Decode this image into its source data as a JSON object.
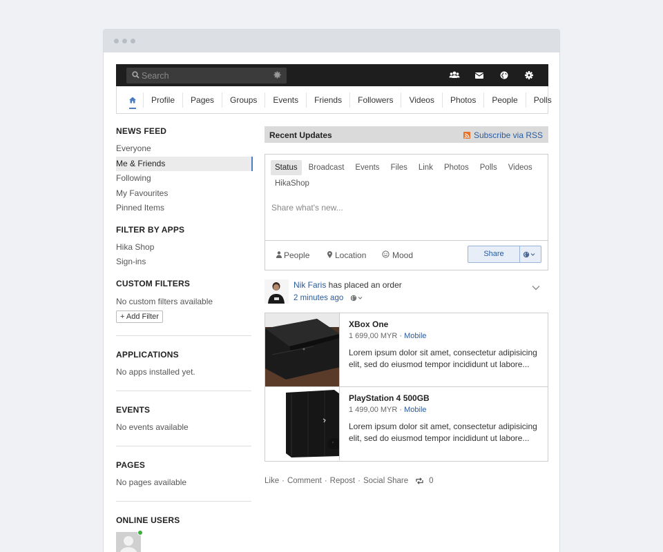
{
  "search": {
    "placeholder": "Search"
  },
  "nav": {
    "items": [
      "Profile",
      "Pages",
      "Groups",
      "Events",
      "Friends",
      "Followers",
      "Videos",
      "Photos",
      "People",
      "Polls"
    ]
  },
  "sidebar": {
    "news_feed_title": "NEWS FEED",
    "feed_items": [
      "Everyone",
      "Me & Friends",
      "Following",
      "My Favourites",
      "Pinned Items"
    ],
    "filter_apps_title": "FILTER BY APPS",
    "app_items": [
      "Hika Shop",
      "Sign-ins"
    ],
    "custom_filters_title": "CUSTOM FILTERS",
    "custom_filters_text": "No custom filters available",
    "add_filter": "+ Add Filter",
    "applications_title": "APPLICATIONS",
    "applications_text": "No apps installed yet.",
    "events_title": "EVENTS",
    "events_text": "No events available",
    "pages_title": "PAGES",
    "pages_text": "No pages available",
    "online_title": "ONLINE USERS"
  },
  "recent": {
    "title": "Recent Updates",
    "rss": "Subscribe via RSS"
  },
  "composer": {
    "tabs": [
      "Status",
      "Broadcast",
      "Events",
      "Files",
      "Link",
      "Photos",
      "Polls",
      "Videos"
    ],
    "tab_row2": "HikaShop",
    "placeholder": "Share what's new...",
    "people": "People",
    "location": "Location",
    "mood": "Mood",
    "share": "Share"
  },
  "post": {
    "author": "Nik Faris",
    "action": " has placed an order",
    "time": "2 minutes ago",
    "products": [
      {
        "name": "XBox One",
        "price": "1 699,00 MYR",
        "category": "Mobile",
        "desc": "Lorem ipsum dolor sit amet, consectetur adipisicing elit, sed do eiusmod tempor incididunt ut labore..."
      },
      {
        "name": "PlayStation 4 500GB",
        "price": "1 499,00 MYR",
        "category": "Mobile",
        "desc": "Lorem ipsum dolor sit amet, consectetur adipisicing elit, sed do eiusmod tempor incididunt ut labore..."
      }
    ],
    "like": "Like",
    "comment": "Comment",
    "repost": "Repost",
    "social_share": "Social Share",
    "repost_count": "0"
  }
}
